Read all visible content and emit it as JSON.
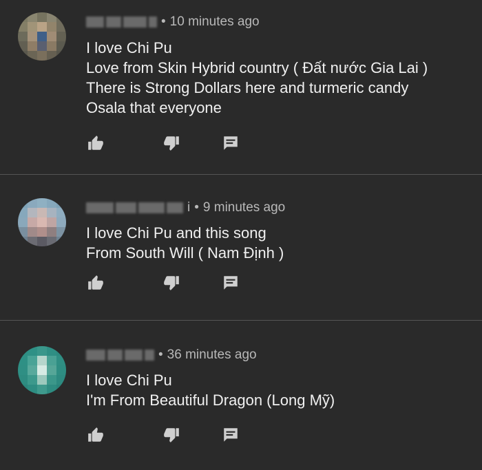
{
  "comments": [
    {
      "time": "10 minutes ago",
      "name_suffix": "",
      "lines": [
        "I love Chi Pu",
        "Love from Skin Hybrid country ( Đất nước Gia Lai )",
        "There is Strong Dollars here and turmeric candy",
        "Osala that everyone"
      ],
      "avatar_colors": [
        "#7d7a63",
        "#8a8670",
        "#76735f",
        "#898571",
        "#6f6c5c",
        "#847f67",
        "#a19478",
        "#b9a386",
        "#92846b",
        "#706c5c",
        "#6d6b5b",
        "#a5927a",
        "#3f5f88",
        "#a08c75",
        "#646153",
        "#625f52",
        "#8f7d66",
        "#5a5f70",
        "#8a7a64",
        "#5b5a4f",
        "#5a584d",
        "#6b6555",
        "#7a6f5c",
        "#655f51",
        "#57554b"
      ]
    },
    {
      "time": "9 minutes ago",
      "name_suffix": "i",
      "lines": [
        "I love Chi Pu and this song",
        "From South Will ( Nam Định )"
      ],
      "avatar_colors": [
        "#7fa3b8",
        "#8aa9bd",
        "#8fb0c2",
        "#86a8bc",
        "#7ea2b7",
        "#86a8bc",
        "#b3b6bd",
        "#c9b8b4",
        "#a7b3bf",
        "#8fadc0",
        "#8aa8bb",
        "#c7a9a6",
        "#d9b8b1",
        "#bfa5a3",
        "#8eaabd",
        "#7a8f9f",
        "#a08a89",
        "#b08f8b",
        "#8f7f80",
        "#7d93a3",
        "#6e7f8e",
        "#6c6c73",
        "#5b5a63",
        "#6a6b73",
        "#6f8190"
      ]
    },
    {
      "time": "36 minutes ago",
      "name_suffix": "",
      "lines": [
        "I love Chi Pu",
        "I'm From Beautiful Dragon (Long Mỹ)"
      ],
      "avatar_colors": [
        "#2f8f84",
        "#2f9186",
        "#3a978b",
        "#2f8f84",
        "#2d8a80",
        "#2e9085",
        "#49a396",
        "#b6d6cc",
        "#4aa194",
        "#2f8e83",
        "#2f8f84",
        "#58a99c",
        "#d7ebe4",
        "#56a698",
        "#2e8d82",
        "#2e8c81",
        "#3c998c",
        "#9cc9bd",
        "#3b978a",
        "#2d8a80",
        "#2b867c",
        "#2e8d82",
        "#3f9a8d",
        "#2e8c81",
        "#2a847a"
      ]
    }
  ],
  "icons": {
    "like": "thumbs-up-icon",
    "dislike": "thumbs-down-icon",
    "reply": "reply-comment-icon"
  },
  "colors": {
    "background": "#2a2a2a",
    "divider": "#555555",
    "text": "#f0f0f0",
    "meta": "#b8b8b8",
    "icon": "#cfcfcf"
  }
}
